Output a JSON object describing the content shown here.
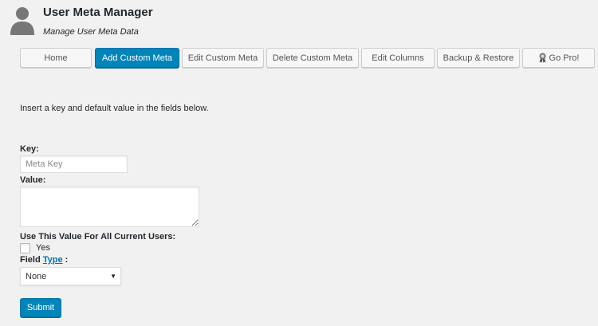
{
  "header": {
    "title": "User Meta Manager",
    "subtitle": "Manage User Meta Data",
    "avatar_icon": "user-silhouette-icon"
  },
  "tabs": [
    {
      "label": "Home",
      "active": false
    },
    {
      "label": "Add Custom Meta",
      "active": true
    },
    {
      "label": "Edit Custom Meta",
      "active": false
    },
    {
      "label": "Delete Custom Meta",
      "active": false
    },
    {
      "label": "Edit Columns",
      "active": false
    },
    {
      "label": "Backup & Restore",
      "active": false
    },
    {
      "label": "Go Pro!",
      "active": false,
      "icon": "award-ribbon-icon"
    }
  ],
  "colors": {
    "accent": "#0085ba",
    "link": "#0073aa",
    "background": "#f1f1f1"
  },
  "form": {
    "intro": "Insert a key and default value in the fields below.",
    "key_label": "Key:",
    "key_placeholder": "Meta Key",
    "key_value": "",
    "value_label": "Value:",
    "value_value": "",
    "all_users_label": "Use This Value For All Current Users:",
    "yes_label": "Yes",
    "yes_checked": false,
    "field_type_prefix": "Field",
    "field_type_link": "Type",
    "field_type_suffix": ":",
    "field_type_selected": "None",
    "submit_label": "Submit"
  }
}
